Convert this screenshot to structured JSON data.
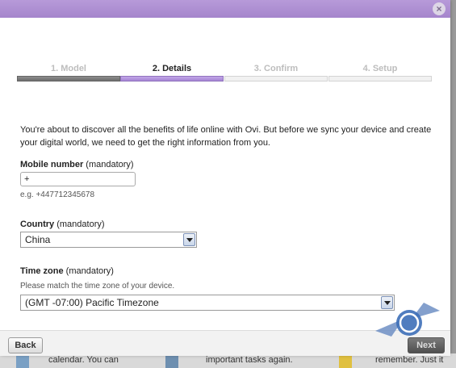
{
  "background": {
    "snippets": [
      "calendar.  You can",
      "important tasks again.",
      "remember.  Just it"
    ]
  },
  "dialog": {
    "close_glyph": "×",
    "steps": [
      {
        "label": "1. Model",
        "state": "done"
      },
      {
        "label": "2. Details",
        "state": "active"
      },
      {
        "label": "3. Confirm",
        "state": "pending"
      },
      {
        "label": "4. Setup",
        "state": "pending"
      }
    ],
    "intro": "You're about to discover all the benefits of life online with Ovi. But before we sync your device and create your digital world, we need to get the right information from you.",
    "mobile": {
      "label": "Mobile number",
      "qualifier": "(mandatory)",
      "value": "+",
      "hint": "e.g. +447712345678"
    },
    "country": {
      "label": "Country",
      "qualifier": "(mandatory)",
      "value": "China"
    },
    "timezone": {
      "label": "Time zone",
      "qualifier": "(mandatory)",
      "hint": "Please match the time zone of your device.",
      "value": "(GMT -07:00) Pacific Timezone"
    },
    "footer": {
      "back_label": "Back",
      "next_label": "Next"
    }
  },
  "colors": {
    "accent": "#a585cc",
    "done": "#7a7a7a"
  }
}
